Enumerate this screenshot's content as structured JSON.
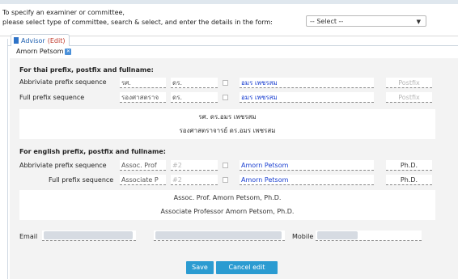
{
  "instructions": {
    "line1": "To specify an examiner or committee,",
    "line2": "please select type of committee, search & select, and enter the details in the form:"
  },
  "committee_select": {
    "value": "-- Select --"
  },
  "tab": {
    "label": "Advisor",
    "edit": "(Edit)"
  },
  "selected_person": {
    "name": "Amorn Petsom"
  },
  "thai": {
    "title": "For thai prefix, postfix and fullname:",
    "abbr": {
      "label": "Abbriviate prefix sequence",
      "p1": "รศ.",
      "p2": "ดร.",
      "name": "อมร เพชรสม",
      "postfix": "Postfix"
    },
    "full": {
      "label": "Full prefix sequence",
      "p1": "รองศาสตราจ",
      "p2": "ดร.",
      "name": "อมร เพชรสม",
      "postfix": "Postfix"
    },
    "preview": {
      "line1": "รศ. ดร.อมร เพชรสม",
      "line2": "รองศาสตราจารย์ ดร.อมร เพชรสม"
    }
  },
  "english": {
    "title": "For english prefix, postfix and fullname:",
    "abbr": {
      "label": "Abbriviate prefix sequence",
      "p1": "Assoc. Prof",
      "p2": "#2",
      "name": "Amorn Petsom",
      "postfix": "Ph.D."
    },
    "full": {
      "label": "Full prefix sequence",
      "p1": "Associate P",
      "p2": "#2",
      "name": "Amorn Petsom",
      "postfix": "Ph.D."
    },
    "preview": {
      "line1": "Assoc. Prof. Amorn Petsom, Ph.D.",
      "line2": "Associate Professor Amorn Petsom, Ph.D."
    }
  },
  "contact": {
    "email_label": "Email",
    "mobile_label": "Mobile"
  },
  "buttons": {
    "save": "Save",
    "cancel": "Cancel edit"
  },
  "colors": {
    "accent": "#2b9bd1",
    "name_blue": "#1a3fd0",
    "edit_red": "#c0392b"
  }
}
